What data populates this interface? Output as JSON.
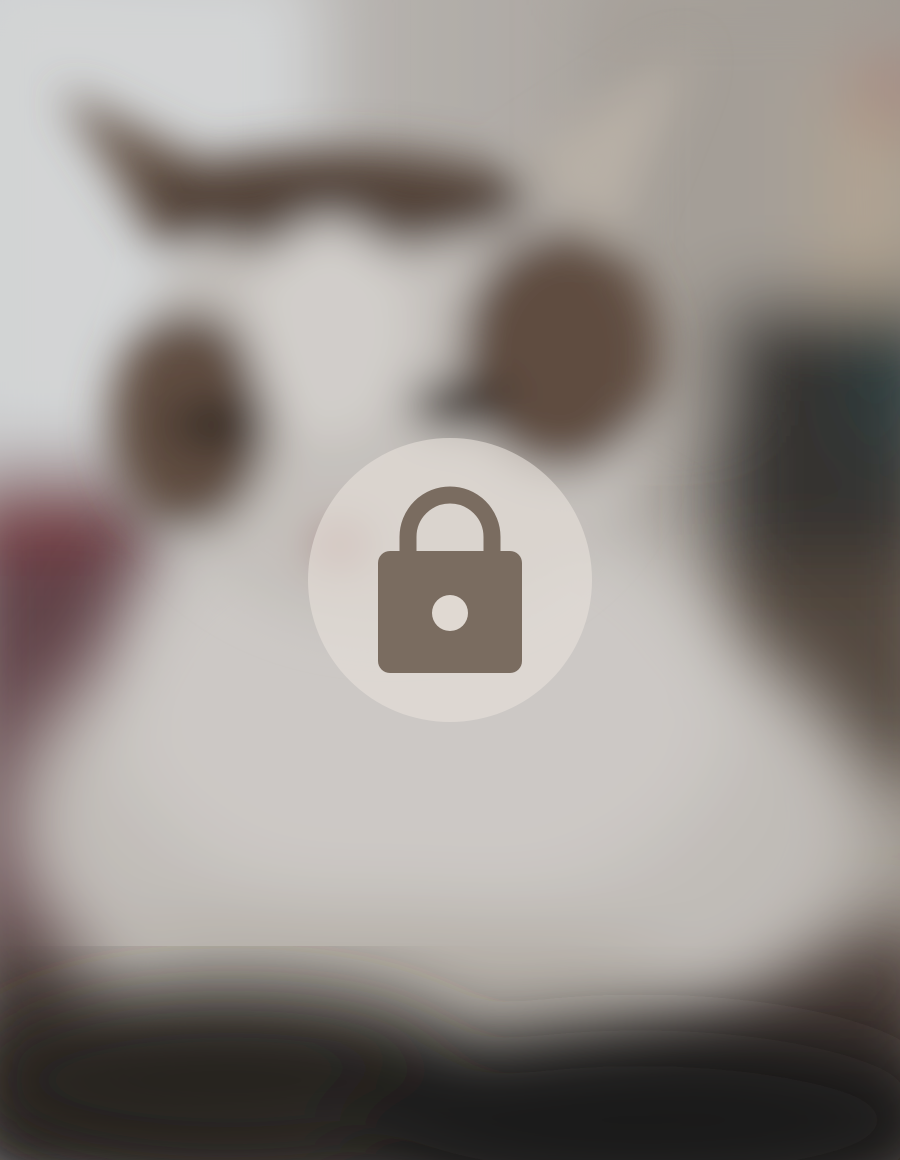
{
  "overlay": {
    "icon": "lock-icon",
    "badge_color": "#e6e0da",
    "icon_color": "#7a6c60"
  },
  "photo": {
    "subject_colors": {
      "fur_light": "#e8e4df",
      "fur_dark": "#5e4e42",
      "background_wall": "#cfcac6",
      "rug": "#6e4a4e"
    }
  }
}
